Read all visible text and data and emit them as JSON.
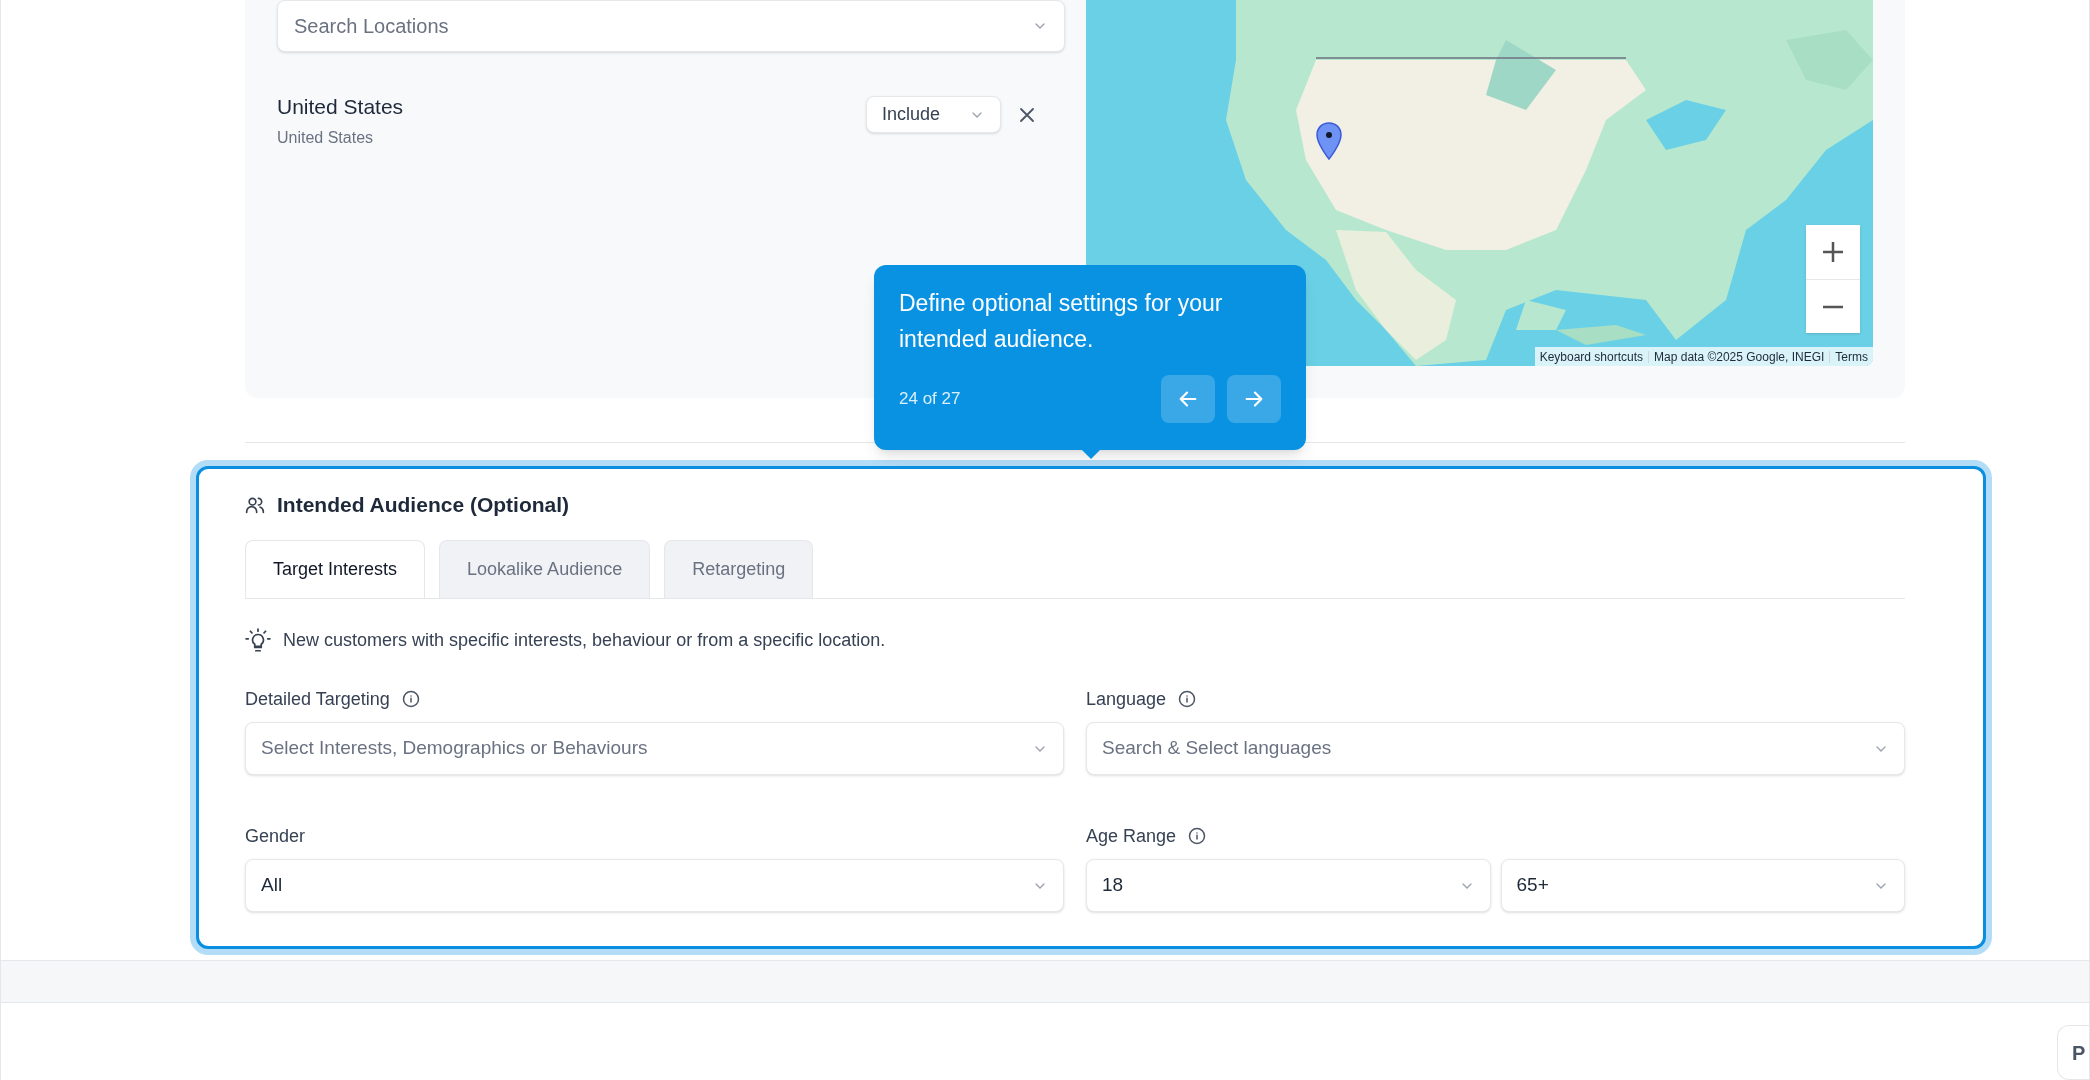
{
  "locations": {
    "search": {
      "placeholder": "Search Locations"
    },
    "items": [
      {
        "name": "United States",
        "subtitle": "United States",
        "mode": "Include"
      }
    ],
    "map": {
      "kind": "picture",
      "attribution": [
        "Keyboard shortcuts",
        "Map data ©2025 Google, INEGI",
        "Terms"
      ]
    }
  },
  "tour_tooltip": {
    "text": "Define optional settings for your intended audience.",
    "progress": "24 of 27"
  },
  "audience": {
    "title": "Intended Audience (Optional)",
    "tabs": [
      {
        "label": "Target Interests",
        "selected": true
      },
      {
        "label": "Lookalike Audience",
        "selected": false
      },
      {
        "label": "Retargeting",
        "selected": false
      }
    ],
    "hint": "New customers with specific interests, behaviour or from a specific location.",
    "fields": [
      {
        "label": "Detailed Targeting",
        "info": true,
        "controls": [
          {
            "placeholder": "Select Interests, Demographics or Behaviours"
          }
        ]
      },
      {
        "label": "Language",
        "info": true,
        "controls": [
          {
            "placeholder": "Search & Select languages"
          }
        ]
      },
      {
        "label": "Gender",
        "info": false,
        "controls": [
          {
            "value": "All"
          }
        ]
      },
      {
        "label": "Age Range",
        "info": true,
        "controls": [
          {
            "value": "18"
          },
          {
            "value": "65+"
          }
        ]
      }
    ]
  },
  "footer_button": {
    "label": "P"
  }
}
